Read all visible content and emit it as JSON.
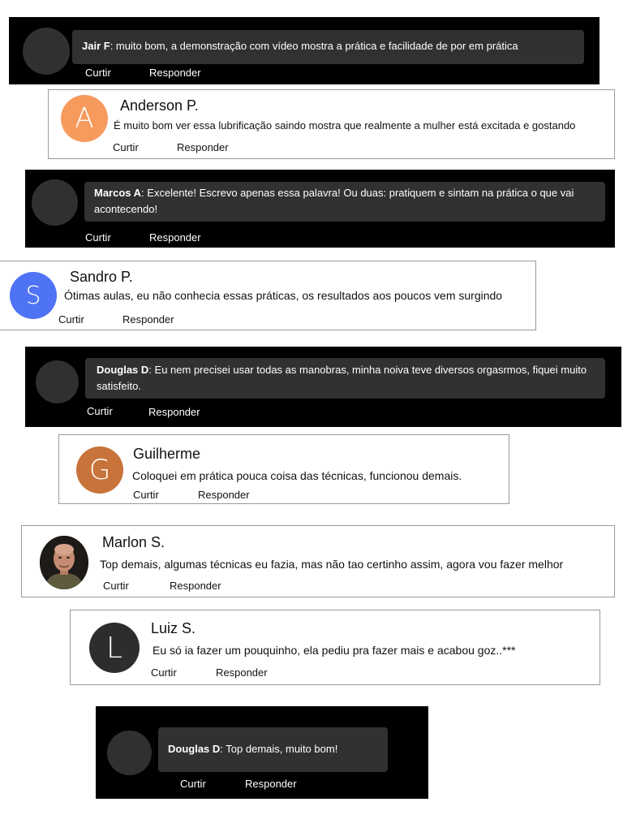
{
  "actions": {
    "like": "Curtir",
    "reply": "Responder"
  },
  "comments": [
    {
      "style": "dark",
      "author": "Jair F",
      "separator": ":",
      "text": " muito bom, a demonstração com vídeo mostra a prática e facilidade de por em prática"
    },
    {
      "style": "light",
      "author": "Anderson P.",
      "avatar_letter": "A",
      "avatar_color": "#f79a5d",
      "text": "É muito bom ver essa lubrificação saindo mostra que realmente a mulher está excitada e gostando"
    },
    {
      "style": "dark",
      "author": "Marcos A",
      "separator": ":",
      "text": " Excelente! Escrevo apenas essa palavra! Ou duas: pratiquem e sintam na prática o que vai acontecendo!"
    },
    {
      "style": "light",
      "author": "Sandro P.",
      "avatar_letter": "S",
      "avatar_color": "#4f73f5",
      "text": "Ótimas aulas, eu não conhecia essas práticas, os resultados aos poucos vem surgindo"
    },
    {
      "style": "dark",
      "author": "Douglas D",
      "separator": ":",
      "text": " Eu nem precisei usar todas as manobras, minha noiva teve diversos orgasrmos, fiquei muito satisfeito."
    },
    {
      "style": "light",
      "author": "Guilherme",
      "avatar_letter": "G",
      "avatar_color": "#c8733a",
      "text": "Coloquei em prática pouca coisa das técnicas, funcionou demais."
    },
    {
      "style": "light",
      "author": "Marlon S.",
      "avatar_type": "photo",
      "text": "Top demais, algumas técnicas eu fazia, mas não tao certinho assim, agora vou fazer melhor"
    },
    {
      "style": "light",
      "author": "Luiz S.",
      "avatar_letter": "L",
      "avatar_color": "#2d2d2d",
      "text": "Eu só ia fazer um pouquinho, ela pediu pra fazer mais e acabou goz..***"
    },
    {
      "style": "dark",
      "author": "Douglas D",
      "separator": ":",
      "text": " Top demais, muito bom!"
    }
  ]
}
